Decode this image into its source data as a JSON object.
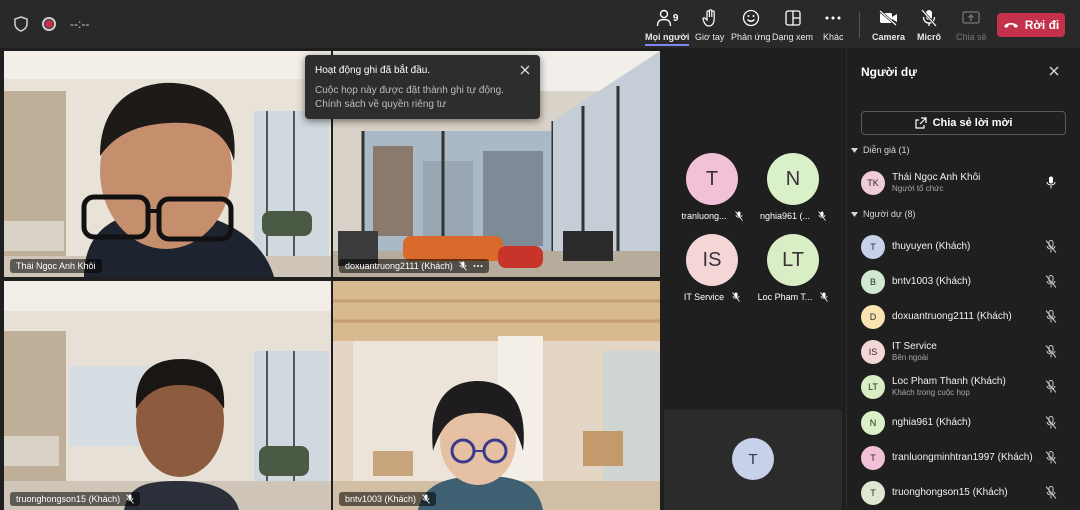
{
  "topbar": {
    "timer": "--:--",
    "buttons": {
      "people_label": "Mọi người",
      "people_count": "9",
      "raise_label": "Giơ tay",
      "react_label": "Phản ứng",
      "view_label": "Dạng xem",
      "more_label": "Khác",
      "camera_label": "Camera",
      "mic_label": "Micrô",
      "share_label": "Chia sẻ"
    },
    "leave_label": "Rời đi"
  },
  "toast": {
    "title": "Hoạt động ghi đã bắt đầu.",
    "body_line1": "Cuộc họp này được đặt thành ghi tự động.",
    "body_line2": "Chính sách về quyền riêng tư"
  },
  "video_tiles": [
    {
      "name": "Thái Ngọc Anh Khôi"
    },
    {
      "name": "doxuantruong2111 (Khách)"
    },
    {
      "name": "truonghongson15 (Khách)"
    },
    {
      "name": "bntv1003 (Khách)"
    }
  ],
  "mini_participants": [
    {
      "initials": "T",
      "name": "tranluong...",
      "color": "#f3c1d7"
    },
    {
      "initials": "N",
      "name": "nghia961 (...",
      "color": "#d9f0c8"
    },
    {
      "initials": "IS",
      "name": "IT Service",
      "color": "#f5d6d6"
    },
    {
      "initials": "LT",
      "name": "Loc Pham T...",
      "color": "#d9eec4"
    }
  ],
  "self_view": {
    "initials": "T"
  },
  "panel": {
    "title": "Người dự",
    "share_invite_label": "Chia sẻ lời mời",
    "presenters_header": "Diễn giả (1)",
    "attendees_header": "Người dự (8)",
    "presenters": [
      {
        "initials": "TK",
        "name": "Thái Ngọc Anh Khôi",
        "sub": "Người tổ chức",
        "color": "#f0cbd9",
        "mic": "on"
      }
    ],
    "attendees": [
      {
        "initials": "T",
        "name": "thuyuyen (Khách)",
        "sub": "",
        "color": "#c7d1ea",
        "mic": "muted"
      },
      {
        "initials": "B",
        "name": "bntv1003 (Khách)",
        "sub": "",
        "color": "#cfe8cf",
        "mic": "muted"
      },
      {
        "initials": "D",
        "name": "doxuantruong2111 (Khách)",
        "sub": "",
        "color": "#f7e4b0",
        "mic": "muted"
      },
      {
        "initials": "IS",
        "name": "IT Service",
        "sub": "Bên ngoài",
        "color": "#f5d6d6",
        "mic": "muted"
      },
      {
        "initials": "LT",
        "name": "Loc Pham Thanh (Khách)",
        "sub": "Khách trong cuộc họp",
        "color": "#d9eec4",
        "mic": "muted"
      },
      {
        "initials": "N",
        "name": "nghia961 (Khách)",
        "sub": "",
        "color": "#d9f0c8",
        "mic": "muted"
      },
      {
        "initials": "T",
        "name": "tranluongminhtran1997 (Khách)",
        "sub": "",
        "color": "#f3c1d7",
        "mic": "muted"
      },
      {
        "initials": "T",
        "name": "truonghongson15 (Khách)",
        "sub": "",
        "color": "#dfe6d2",
        "mic": "muted"
      }
    ]
  }
}
